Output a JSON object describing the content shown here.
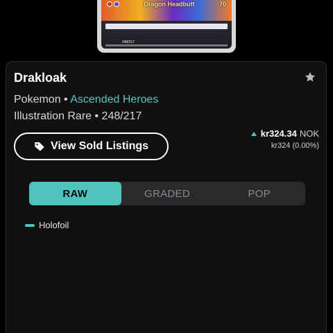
{
  "card_image": {
    "attack_name": "Dragon Headbutt",
    "attack_damage": "70",
    "card_number": "248/217"
  },
  "product": {
    "name": "Drakloak",
    "category": "Pokemon",
    "separator": "•",
    "set_name": "Ascended Heroes",
    "rarity_line": "Illustration Rare • 248/217"
  },
  "actions": {
    "sold_listings_label": "View Sold Listings",
    "favorite_icon": "star-icon",
    "tag_icon": "tag-icon"
  },
  "price": {
    "main_value": "kr324.34",
    "currency": "NOK",
    "sub_line": "kr324 (0.00%)",
    "trend": "up",
    "trend_color": "#55c7bf"
  },
  "tabs": [
    {
      "label": "RAW",
      "active": true
    },
    {
      "label": "GRADED",
      "active": false
    },
    {
      "label": "POP",
      "active": false
    }
  ],
  "legend": {
    "label": "Holofoil",
    "color": "#4fc4bc"
  },
  "colors": {
    "accent": "#4fc4bc",
    "link": "#55c7bf",
    "background": "#000000",
    "panel": "#101012"
  }
}
